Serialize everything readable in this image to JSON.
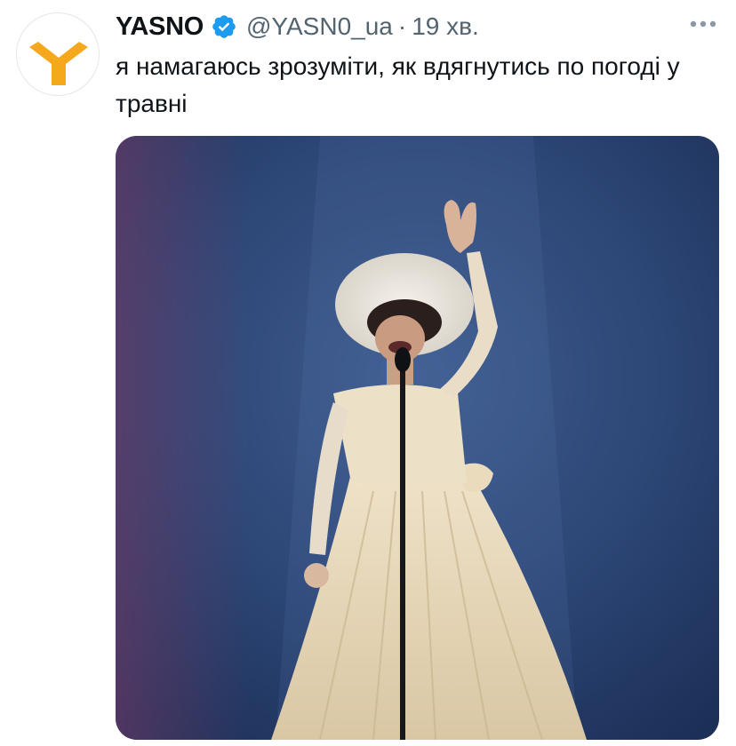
{
  "tweet": {
    "author_name": "YASNO",
    "verified_icon": "verified-badge-icon",
    "handle": "@YASN0_ua",
    "separator": "·",
    "time": "19 хв.",
    "text": "я намагаюсь зрозуміти, як вдягнутись по погоді у травні",
    "more_icon": "more-options-icon",
    "avatar_icon": "yasno-logo-icon"
  },
  "colors": {
    "accent": "#1d9bf0",
    "logo": "#f6a81c",
    "text": "#0f1419",
    "muted": "#536471"
  }
}
